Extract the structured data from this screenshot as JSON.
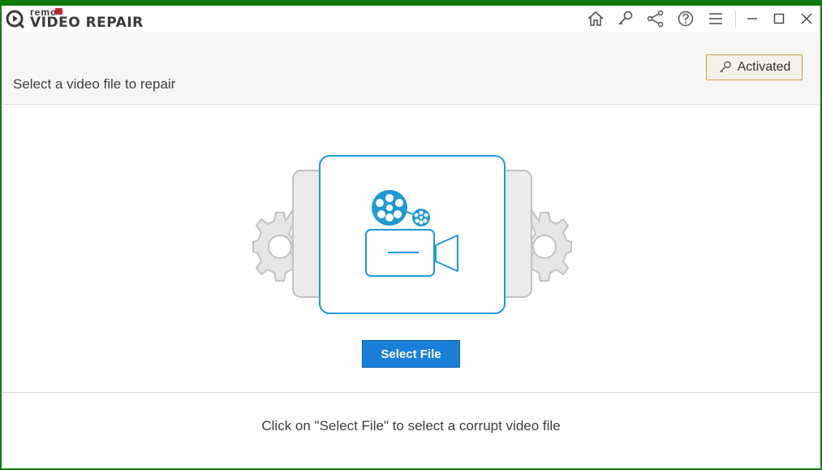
{
  "app": {
    "brand_small": "remo",
    "brand_name": "VIDEO REPAIR"
  },
  "toolbar": {
    "icons": [
      "home-icon",
      "key-icon",
      "share-icon",
      "help-icon",
      "menu-icon"
    ],
    "window_controls": [
      "minimize-icon",
      "maximize-icon",
      "close-icon"
    ]
  },
  "header": {
    "title": "Select a video file to repair",
    "activated_label": "Activated"
  },
  "main": {
    "select_button_label": "Select File",
    "hint_text": "Click on \"Select File\" to select a corrupt video file"
  },
  "colors": {
    "accent": "#1a7fd9",
    "illustration_blue": "#1e9ad6",
    "window_border": "#107c10",
    "activated_border": "#d79a45"
  }
}
